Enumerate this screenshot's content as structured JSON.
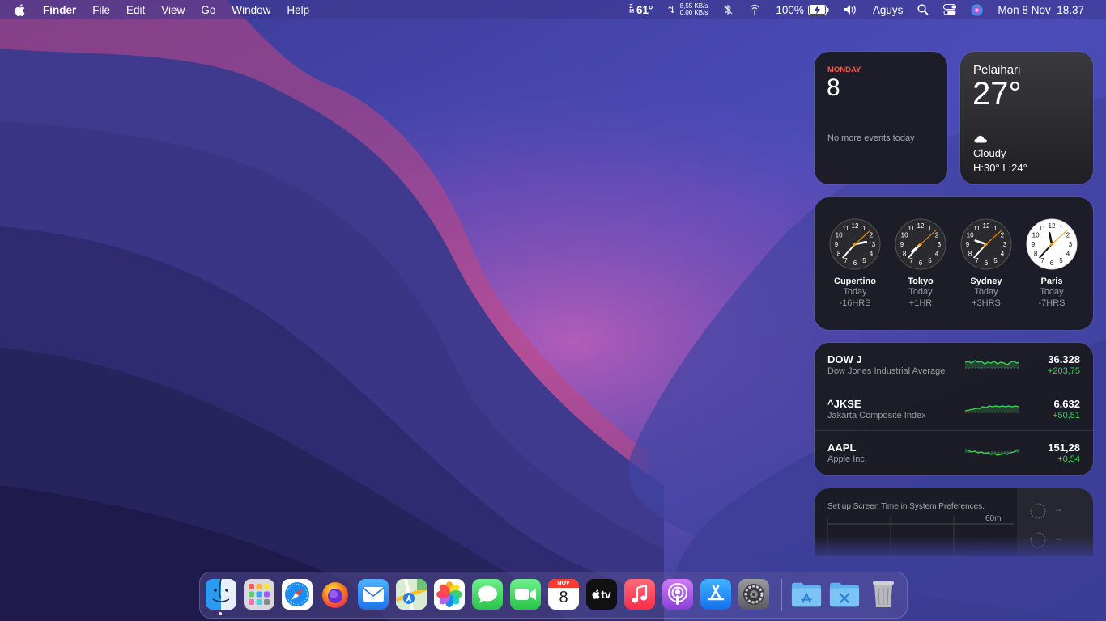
{
  "menubar": {
    "app_name": "Finder",
    "menus": [
      "File",
      "Edit",
      "View",
      "Go",
      "Window",
      "Help"
    ],
    "cpu_temp_label": [
      "Z",
      "M"
    ],
    "temperature": "61°",
    "net_up": "8,55 KB/s",
    "net_down": "0,00 KB/s",
    "battery": "100%",
    "user": "Aguys",
    "datetime": "Mon 8 Nov  18.37"
  },
  "calendar_widget": {
    "weekday": "MONDAY",
    "date": "8",
    "note": "No more events today"
  },
  "weather_widget": {
    "city": "Pelaihari",
    "temperature": "27°",
    "condition": "Cloudy",
    "high_low": "H:30° L:24°"
  },
  "clock_widget": {
    "clocks": [
      {
        "city": "Cupertino",
        "day": "Today",
        "offset": "-16HRS",
        "hour": 2,
        "minute": 37,
        "theme": "dark"
      },
      {
        "city": "Tokyo",
        "day": "Today",
        "offset": "+1HR",
        "hour": 19,
        "minute": 37,
        "theme": "dark"
      },
      {
        "city": "Sydney",
        "day": "Today",
        "offset": "+3HRS",
        "hour": 21,
        "minute": 37,
        "theme": "dark"
      },
      {
        "city": "Paris",
        "day": "Today",
        "offset": "-7HRS",
        "hour": 11,
        "minute": 37,
        "theme": "light"
      }
    ]
  },
  "stocks_widget": {
    "stocks": [
      {
        "symbol": "DOW J",
        "name": "Dow Jones Industrial Average",
        "value": "36.328",
        "change": "+203,75"
      },
      {
        "symbol": "^JKSE",
        "name": "Jakarta Composite Index",
        "value": "6.632",
        "change": "+50,51"
      },
      {
        "symbol": "AAPL",
        "name": "Apple Inc.",
        "value": "151,28",
        "change": "+0,54"
      }
    ],
    "positive_color": "#39d353"
  },
  "screen_time_widget": {
    "text": "Set up Screen Time in System Preferences.",
    "axis_label": "60m",
    "placeholder": "--"
  },
  "dock": {
    "apps": [
      {
        "name": "Finder",
        "icon": "finder-icon",
        "running": true
      },
      {
        "name": "Launchpad",
        "icon": "launchpad-icon"
      },
      {
        "name": "Safari",
        "icon": "safari-icon"
      },
      {
        "name": "Firefox",
        "icon": "firefox-icon"
      },
      {
        "name": "Mail",
        "icon": "mail-icon"
      },
      {
        "name": "Maps",
        "icon": "maps-icon"
      },
      {
        "name": "Photos",
        "icon": "photos-icon"
      },
      {
        "name": "Messages",
        "icon": "messages-icon"
      },
      {
        "name": "FaceTime",
        "icon": "facetime-icon"
      },
      {
        "name": "Calendar",
        "icon": "calendar-icon",
        "month": "NOV",
        "day": "8"
      },
      {
        "name": "TV",
        "icon": "tv-icon",
        "label": "tv"
      },
      {
        "name": "Music",
        "icon": "music-icon"
      },
      {
        "name": "Podcasts",
        "icon": "podcasts-icon"
      },
      {
        "name": "App Store",
        "icon": "app-store-icon"
      },
      {
        "name": "System Preferences",
        "icon": "system-preferences-icon"
      },
      {
        "name": "Applications",
        "icon": "applications-folder-icon"
      },
      {
        "name": "Utilities",
        "icon": "utilities-folder-icon"
      },
      {
        "name": "Trash",
        "icon": "trash-icon"
      }
    ]
  }
}
